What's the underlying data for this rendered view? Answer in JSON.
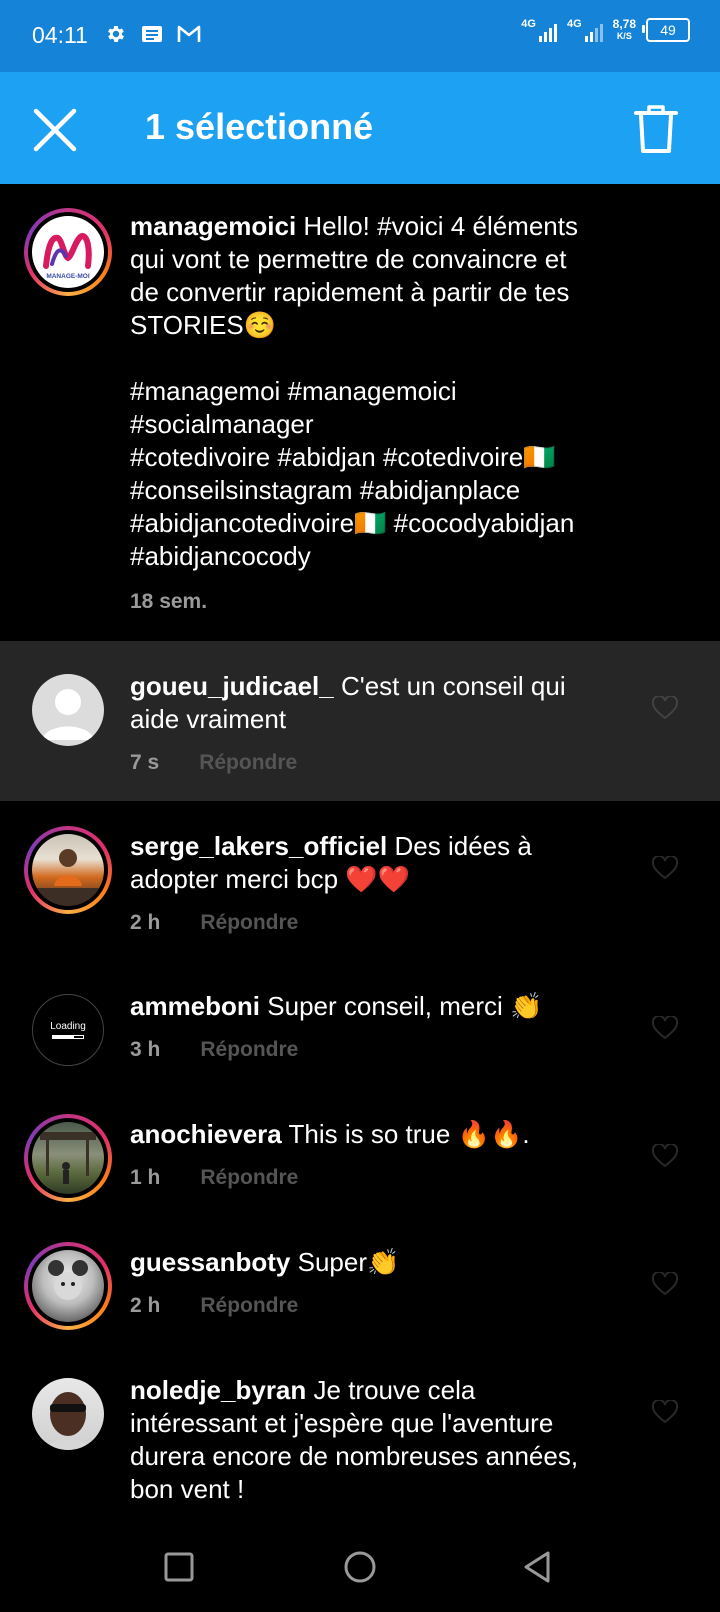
{
  "status_bar": {
    "time": "04:11",
    "net1": "4G",
    "net2": "4G",
    "speed_value": "8,78",
    "speed_unit": "K/S",
    "battery": "49",
    "icons": [
      "settings-icon",
      "message-icon",
      "gmail-icon"
    ]
  },
  "action_bar": {
    "title": "1 sélectionné",
    "close_icon": "close-icon",
    "delete_icon": "trash-icon"
  },
  "post": {
    "username": "managemoici",
    "lines": [
      "Hello! #voici 4 éléments",
      "qui vont te permettre de convaincre et",
      "de convertir rapidement à partir de tes",
      "STORIES☺️",
      "",
      "#managemoi #managemoici",
      "#socialmanager",
      "#cotedivoire #abidjan #cotedivoire🇨🇮",
      "#conseilsinstagram #abidjanplace",
      "#abidjancotedivoire🇨🇮 #cocodyabidjan",
      "#abidjancocody"
    ],
    "time": "18 sem.",
    "avatar_label": "MANAGE-MOI"
  },
  "reply_label": "Répondre",
  "comments": [
    {
      "username": "goueu_judicael_",
      "lines": [
        "C'est un conseil qui",
        "aide vraiment"
      ],
      "time": "7 s",
      "selected": true
    },
    {
      "username": "serge_lakers_officiel",
      "lines": [
        "Des idées à",
        "adopter merci bcp ❤️❤️"
      ],
      "time": "2 h"
    },
    {
      "username": "ammeboni",
      "lines": [
        "Super conseil, merci 👏"
      ],
      "time": "3 h",
      "avatar_text": "Loading"
    },
    {
      "username": "anochievera",
      "lines": [
        "This is so true 🔥🔥."
      ],
      "time": "1 h"
    },
    {
      "username": "guessanboty",
      "lines": [
        "Super👏"
      ],
      "time": "2 h"
    },
    {
      "username": "noledje_byran",
      "lines": [
        "Je trouve cela",
        "intéressant et j'espère que l'aventure",
        "durera encore de nombreuses années,",
        "bon vent !"
      ],
      "time": ""
    }
  ],
  "nav": [
    "recents-button",
    "home-button",
    "back-button"
  ]
}
